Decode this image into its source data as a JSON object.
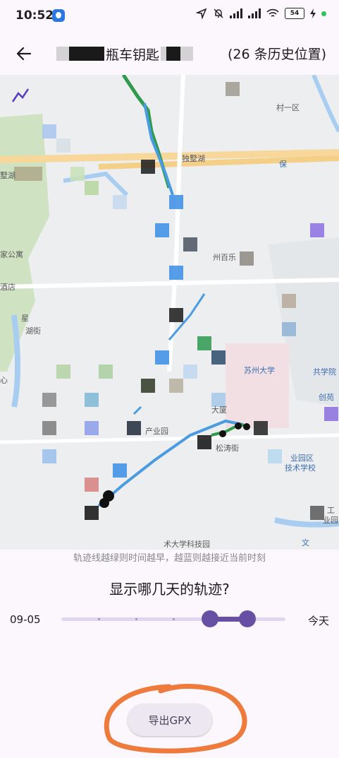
{
  "status_bar": {
    "time": "10:52",
    "battery": "54"
  },
  "header": {
    "title_visible": "瓶车钥匙",
    "history_count": "(26 条历史位置)"
  },
  "map": {
    "labels": [
      "村一区",
      "独墅湖",
      "墅湖",
      "州百乐",
      "家公寓",
      "酒店",
      "湖街",
      "星",
      "共学院",
      "创苑",
      "产业园",
      "松涛街",
      "业园区",
      "技术学校",
      "工",
      "业园",
      "文",
      "术大学科技园",
      "大厦",
      "保",
      "心",
      "苏州大学"
    ]
  },
  "hint": "轨迹线越绿则时间越早，越蓝则越接近当前时刻",
  "range": {
    "question": "显示哪几天的轨迹?",
    "start_label": "09-05",
    "end_label": "今天"
  },
  "export_button": "导出GPX"
}
